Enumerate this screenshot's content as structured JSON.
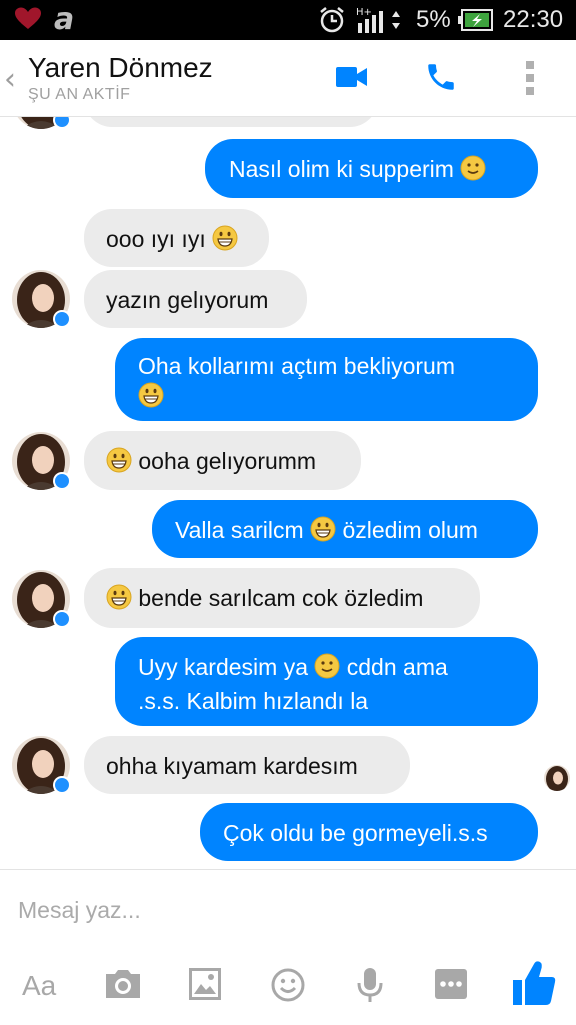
{
  "status_bar": {
    "battery_percent": "5%",
    "time": "22:30",
    "app_letter": "a",
    "network": "H+"
  },
  "header": {
    "contact_name": "Yaren Dönmez",
    "contact_status": "ŞU AN AKTİF"
  },
  "messages": [
    {
      "dir": "out",
      "text": "Nasıl olim ki supperim",
      "emoji": "slight-smile"
    },
    {
      "dir": "in",
      "text": "ooo ıyı ıyı",
      "emoji": "grin"
    },
    {
      "dir": "in",
      "text": "yazın gelıyorum"
    },
    {
      "dir": "out",
      "text": "Oha kollarımı açtım bekliyorum",
      "emoji": "grin"
    },
    {
      "dir": "in",
      "text": "ooha gelıyorumm",
      "emoji": "grin"
    },
    {
      "dir": "out",
      "text_before": "Valla sarilcm",
      "text_after": "özledim olum",
      "emoji": "grin"
    },
    {
      "dir": "in",
      "text": "bende sarılcam cok özledim",
      "emoji": "grin"
    },
    {
      "dir": "out",
      "text_before": "Uyy kardesim ya",
      "text_after": "cddn ama",
      "line2": ".s.s. Kalbim hızlandı la",
      "emoji": "slight-smile"
    },
    {
      "dir": "in",
      "text": "ohha kıyamam kardesım"
    },
    {
      "dir": "out",
      "text": "Çok oldu be gormeyeli.s.s"
    }
  ],
  "input": {
    "placeholder": "Mesaj yaz...",
    "value": ""
  },
  "toolbar": {
    "text_style_label": "Aa"
  },
  "colors": {
    "accent": "#0084ff",
    "incoming_bubble": "#ebebeb",
    "icon_gray": "#a8a8a8"
  }
}
